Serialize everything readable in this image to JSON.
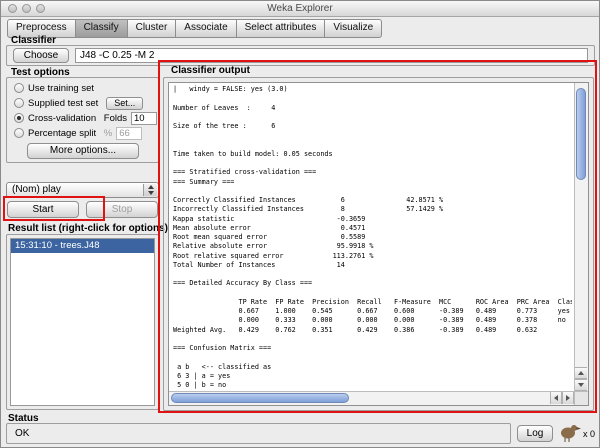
{
  "window": {
    "title": "Weka Explorer"
  },
  "tabs": [
    {
      "label": "Preprocess",
      "active": false
    },
    {
      "label": "Classify",
      "active": true
    },
    {
      "label": "Cluster",
      "active": false
    },
    {
      "label": "Associate",
      "active": false
    },
    {
      "label": "Select attributes",
      "active": false
    },
    {
      "label": "Visualize",
      "active": false
    }
  ],
  "classifier": {
    "section_title": "Classifier",
    "choose_label": "Choose",
    "value": "J48 -C 0.25 -M 2"
  },
  "test_options": {
    "section_title": "Test options",
    "options": [
      {
        "label": "Use training set",
        "selected": false
      },
      {
        "label": "Supplied test set",
        "selected": false,
        "button_label": "Set..."
      },
      {
        "label": "Cross-validation",
        "selected": true,
        "field_label": "Folds",
        "field_value": "10"
      },
      {
        "label": "Percentage split",
        "selected": false,
        "field_label": "%",
        "field_value": "66"
      }
    ],
    "more_options_label": "More options..."
  },
  "class_selector": {
    "value": "(Nom) play"
  },
  "run_controls": {
    "start_label": "Start",
    "stop_label": "Stop"
  },
  "result_list": {
    "section_title": "Result list (right-click for options)",
    "items": [
      {
        "label": "15:31:10 - trees.J48",
        "selected": true
      }
    ]
  },
  "output": {
    "section_title": "Classifier output",
    "lines": [
      "|   windy = FALSE: yes (3.0)",
      "",
      "Number of Leaves  :     4",
      "",
      "Size of the tree :      6",
      "",
      "",
      "Time taken to build model: 0.05 seconds",
      "",
      "=== Stratified cross-validation ===",
      "=== Summary ===",
      "",
      "Correctly Classified Instances           6               42.8571 %",
      "Incorrectly Classified Instances         8               57.1429 %",
      "Kappa statistic                         -0.3659",
      "Mean absolute error                      0.4571",
      "Root mean squared error                  0.5589",
      "Relative absolute error                 95.9918 %",
      "Root relative squared error            113.2761 %",
      "Total Number of Instances               14",
      "",
      "=== Detailed Accuracy By Class ===",
      "",
      "                TP Rate  FP Rate  Precision  Recall   F-Measure  MCC      ROC Area  PRC Area  Class",
      "                0.667    1.000    0.545      0.667    0.600      -0.389   0.489     0.773     yes",
      "                0.000    0.333    0.000      0.000    0.000      -0.389   0.489     0.378     no",
      "Weighted Avg.   0.429    0.762    0.351      0.429    0.386      -0.389   0.489     0.632",
      "",
      "=== Confusion Matrix ===",
      "",
      " a b   <-- classified as",
      " 6 3 | a = yes",
      " 5 0 | b = no"
    ]
  },
  "status": {
    "section_title": "Status",
    "message": "OK",
    "log_label": "Log",
    "weka_counter": "x 0"
  },
  "colors": {
    "annotation_red": "#e01212",
    "selection_blue": "#3b64a0",
    "panel_background": "#ececec"
  }
}
